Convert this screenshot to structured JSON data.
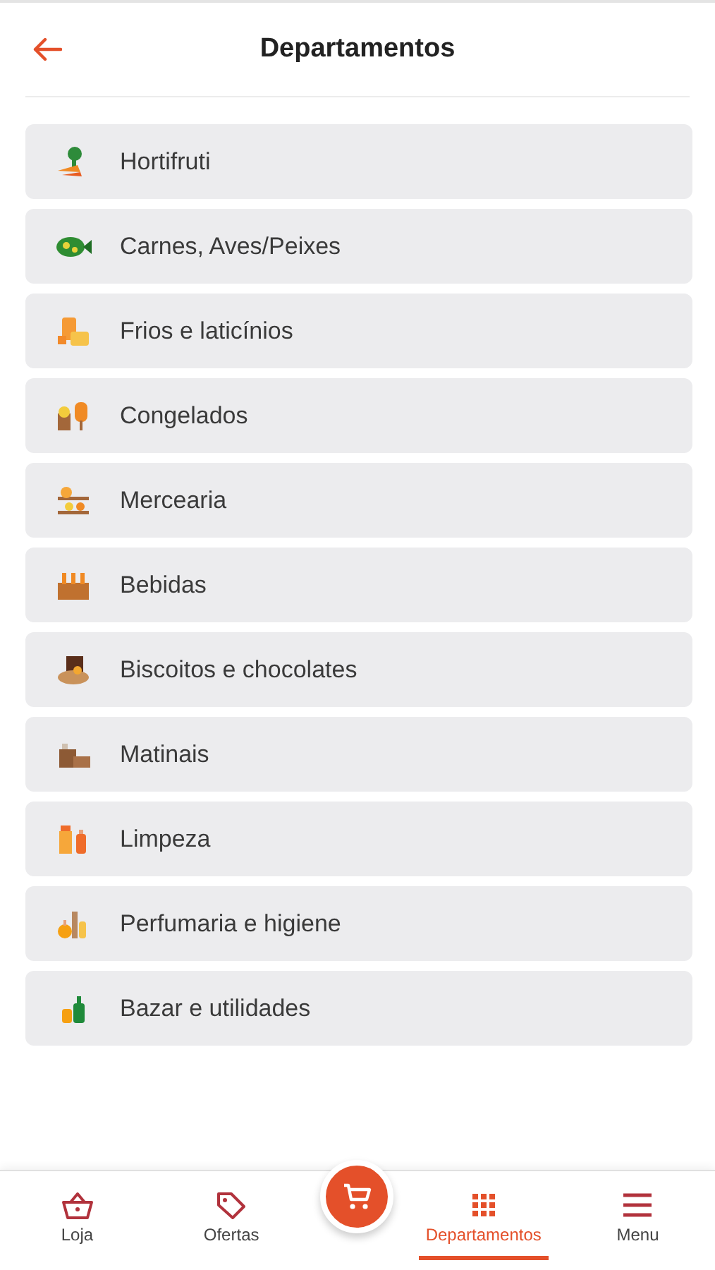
{
  "header": {
    "title": "Departamentos"
  },
  "departments": [
    {
      "label": "Hortifruti"
    },
    {
      "label": "Carnes, Aves/Peixes"
    },
    {
      "label": "Frios e laticínios"
    },
    {
      "label": "Congelados"
    },
    {
      "label": "Mercearia"
    },
    {
      "label": "Bebidas"
    },
    {
      "label": "Biscoitos e chocolates"
    },
    {
      "label": "Matinais"
    },
    {
      "label": "Limpeza"
    },
    {
      "label": "Perfumaria e higiene"
    },
    {
      "label": "Bazar e utilidades"
    }
  ],
  "bottom_nav": [
    {
      "kind": "basket",
      "label": "Loja",
      "selected": false
    },
    {
      "kind": "tag",
      "label": "Ofertas",
      "selected": false
    },
    {
      "kind": "cart",
      "selected": false
    },
    {
      "kind": "grid",
      "label": "Departamentos",
      "selected": true
    },
    {
      "kind": "menu",
      "label": "Menu",
      "selected": false
    }
  ]
}
